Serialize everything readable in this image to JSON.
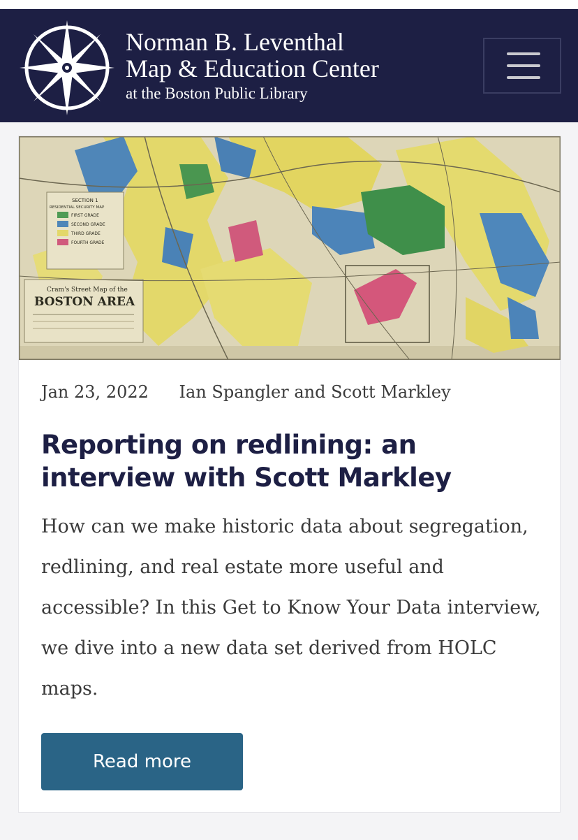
{
  "header": {
    "org_line1": "Norman B. Leventhal",
    "org_line2": "Map & Education Center",
    "org_line3": "at the Boston Public Library",
    "menu_icon": "hamburger-menu-icon",
    "background_color": "#1d1f44"
  },
  "article": {
    "image_alt": "Cram's Street Map of the Boston Area with HOLC residential security grades",
    "map_text": {
      "section": "SECTION 1",
      "map_kind": "RESIDENTIAL SECURITY MAP",
      "legend": [
        "FIRST GRADE",
        "SECOND GRADE",
        "THIRD GRADE",
        "FOURTH GRADE"
      ],
      "map_title_small": "Cram's Street Map of the",
      "map_title_big": "BOSTON AREA"
    },
    "date": "Jan 23, 2022",
    "authors": "Ian Spangler and Scott Markley",
    "title": "Reporting on redlining: an interview with Scott Markley",
    "excerpt": "How can we make historic data about segregation, redlining, and real estate more useful and accessible? In this Get to Know Your Data interview, we dive into a new data set derived from HOLC maps.",
    "read_more_label": "Read more",
    "button_color": "#2a6486"
  }
}
